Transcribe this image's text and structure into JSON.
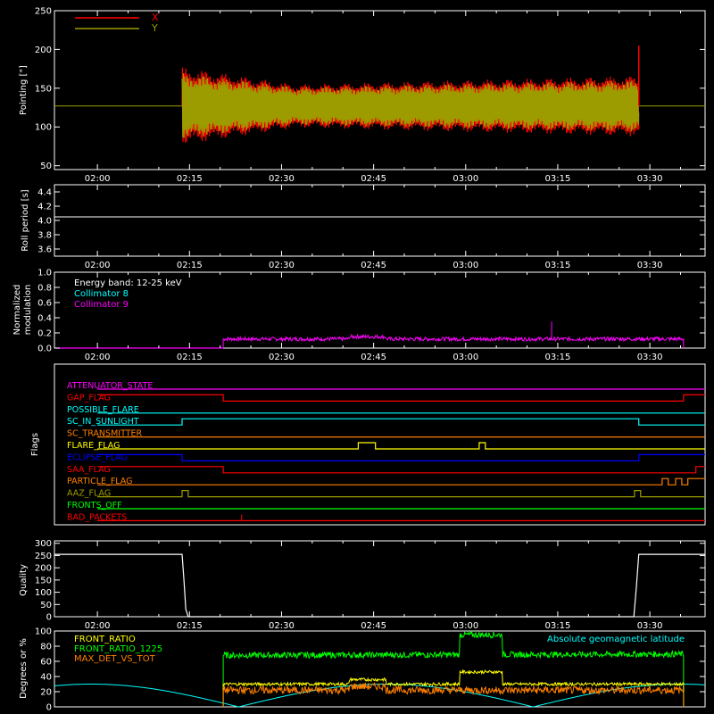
{
  "time_ticks": [
    "02:00",
    "02:15",
    "02:30",
    "02:45",
    "03:00",
    "03:15",
    "03:30"
  ],
  "colors": {
    "bg": "#000000",
    "axis": "#ffffff",
    "red": "#ff0000",
    "olive": "#9c9c00",
    "olive_line": "#a0a000",
    "cyan": "#00ffff",
    "magenta": "#ff00ff",
    "yellow": "#ffff00",
    "blue": "#0000ff",
    "orange": "#ff8000",
    "green": "#00ff00",
    "white": "#ffffff"
  },
  "chart_data": [
    {
      "type": "line",
      "ylabel": "Pointing [\"]",
      "ylim": [
        45,
        250
      ],
      "yticks": [
        "50",
        "100",
        "150",
        "200",
        "250"
      ],
      "ytick_values": [
        50,
        100,
        150,
        200,
        250
      ],
      "legend_placement": "top-left",
      "series": [
        {
          "name": "X",
          "color": "#ff0000",
          "active": [
            13.8,
            88.2
          ],
          "center": 127,
          "amp_start": 45,
          "amp_mid": 25,
          "amp_end": 35
        },
        {
          "name": "Y",
          "color": "#9c9c00",
          "active": [
            13.8,
            88.2
          ],
          "center": 127,
          "amp_start": 38,
          "amp_mid": 22,
          "amp_end": 30
        }
      ],
      "reference_line": 127,
      "spike_end": [
        88.2,
        205
      ]
    },
    {
      "type": "line",
      "ylabel": "Roll period [s]",
      "ylim": [
        3.5,
        4.5
      ],
      "yticks": [
        "3.6",
        "3.8",
        "4.0",
        "4.2",
        "4.4"
      ],
      "ytick_values": [
        3.6,
        3.8,
        4.0,
        4.2,
        4.4
      ],
      "series": [
        {
          "name": "",
          "color": "#ffffff",
          "value": 4.05
        }
      ]
    },
    {
      "type": "line",
      "ylabel": "Normalized modulation",
      "ylabel_lines": [
        "Normalized",
        "modulation"
      ],
      "ylim": [
        0,
        1
      ],
      "yticks": [
        "0.0",
        "0.2",
        "0.4",
        "0.6",
        "0.8",
        "1.0"
      ],
      "ytick_values": [
        0.0,
        0.2,
        0.4,
        0.6,
        0.8,
        1.0
      ],
      "legend": [
        "Energy band: 12-25 keV",
        "Collimator 8",
        "Collimator 9"
      ],
      "legend_colors": [
        "#ffffff",
        "#00ffff",
        "#ff00ff"
      ],
      "series": [
        {
          "name": "Collimator 9",
          "color": "#ff00ff",
          "active": [
            20.5,
            95.5
          ],
          "level": 0.12,
          "spike": [
            74,
            0.35
          ]
        }
      ]
    },
    {
      "type": "line",
      "ylabel": "Flags",
      "ylim": [
        0,
        12
      ],
      "flags": [
        {
          "name": "ATTENUATOR_STATE",
          "color": "#ff00ff",
          "segments": [
            [
              0,
              99,
              0
            ]
          ]
        },
        {
          "name": "GAP_FLAG",
          "color": "#ff0000",
          "segments": [
            [
              0,
              20.5,
              1
            ],
            [
              20.5,
              95.5,
              0
            ],
            [
              95.5,
              99,
              1
            ]
          ]
        },
        {
          "name": "POSSIBLE_FLARE",
          "color": "#00ffff",
          "segments": [
            [
              0,
              99,
              0
            ]
          ]
        },
        {
          "name": "SC_IN_SUNLIGHT",
          "color": "#00ffff",
          "segments": [
            [
              0,
              13.8,
              0
            ],
            [
              13.8,
              88.2,
              1
            ],
            [
              88.2,
              99,
              0
            ]
          ]
        },
        {
          "name": "SC_TRANSMITTER",
          "color": "#ff8000",
          "segments": [
            [
              0,
              99,
              0
            ]
          ]
        },
        {
          "name": "FLARE_FLAG",
          "color": "#ffff00",
          "segments": [
            [
              0,
              42.5,
              0
            ],
            [
              42.5,
              45.3,
              1
            ],
            [
              45.3,
              62.2,
              0
            ],
            [
              62.2,
              63.2,
              1
            ],
            [
              63.2,
              99,
              0
            ]
          ]
        },
        {
          "name": "ECLIPSE_FLAG",
          "color": "#0000ff",
          "segments": [
            [
              0,
              13.8,
              1
            ],
            [
              13.8,
              88.2,
              0
            ],
            [
              88.2,
              99,
              1
            ]
          ]
        },
        {
          "name": "SAA_FLAG",
          "color": "#ff0000",
          "segments": [
            [
              0,
              20.5,
              1
            ],
            [
              20.5,
              97.5,
              0
            ],
            [
              97.5,
              99,
              1
            ]
          ]
        },
        {
          "name": "PARTICLE_FLAG",
          "color": "#ff8000",
          "segments": [
            [
              0,
              92,
              0
            ],
            [
              92,
              93,
              1
            ],
            [
              93,
              94.2,
              0
            ],
            [
              94.2,
              95.2,
              1
            ],
            [
              95.2,
              96.2,
              0
            ],
            [
              96.2,
              99,
              1
            ]
          ]
        },
        {
          "name": "AAZ_FLAG",
          "color": "#9c9c00",
          "segments": [
            [
              0,
              13.8,
              0
            ],
            [
              13.8,
              14.8,
              1
            ],
            [
              14.8,
              87.5,
              0
            ],
            [
              87.5,
              88.5,
              1
            ],
            [
              88.5,
              99,
              0
            ]
          ]
        },
        {
          "name": "FRONTS_OFF",
          "color": "#00ff00",
          "segments": [
            [
              0,
              99,
              0
            ]
          ]
        },
        {
          "name": "BAD_PACKETS",
          "color": "#ff0000",
          "segments": [
            [
              0,
              99,
              0
            ]
          ]
        }
      ]
    },
    {
      "type": "line",
      "ylabel": "Quality",
      "ylim": [
        0,
        310
      ],
      "yticks": [
        "0",
        "50",
        "100",
        "150",
        "200",
        "250",
        "300"
      ],
      "ytick_values": [
        0,
        50,
        100,
        150,
        200,
        250,
        300
      ],
      "series": [
        {
          "name": "",
          "color": "#ffffff",
          "high": 255,
          "low": 0,
          "drop": 13.8,
          "rise": 88.2
        }
      ]
    },
    {
      "type": "line",
      "ylabel": "Degrees or %",
      "ylim": [
        0,
        100
      ],
      "yticks": [
        "0",
        "20",
        "40",
        "60",
        "80",
        "100"
      ],
      "ytick_values": [
        0,
        20,
        40,
        60,
        80,
        100
      ],
      "legend": [
        "FRONT_RATIO",
        "FRONT_RATIO_1225",
        "MAX_DET_VS_TOT"
      ],
      "legend_colors": [
        "#ffff00",
        "#00ff00",
        "#ff8000"
      ],
      "annotation": "Absolute geomagnetic latitude",
      "annotation_color": "#00ffff",
      "series": [
        {
          "name": "FRONT_RATIO",
          "color": "#ffff00",
          "active": [
            20.5,
            95.5
          ],
          "level": 30
        },
        {
          "name": "FRONT_RATIO_1225",
          "color": "#00ff00",
          "active": [
            20.5,
            95.5
          ],
          "level": 68
        },
        {
          "name": "MAX_DET_VS_TOT",
          "color": "#ff8000",
          "active": [
            20.5,
            95.5
          ],
          "level": 22
        },
        {
          "name": "Absolute geomagnetic latitude",
          "color": "#00ffff"
        }
      ]
    }
  ]
}
